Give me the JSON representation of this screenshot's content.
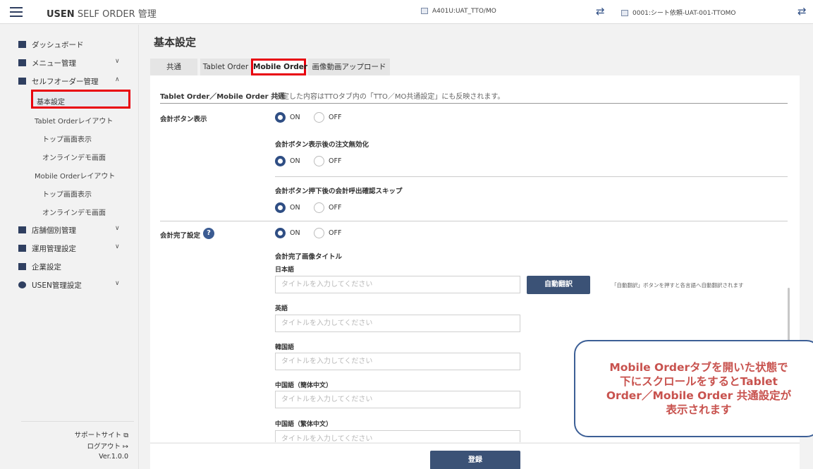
{
  "header": {
    "brand_bold": "USEN",
    "brand_rest": " SELF ORDER 管理",
    "store": "A401U:UAT_TTO/MO",
    "terminal": "0001:シート依頼-UAT-001-TTOMO",
    "swap_glyph": "⇄"
  },
  "sidebar": {
    "items": [
      {
        "label": "ダッシュボード",
        "icon": "dashboard-icon"
      },
      {
        "label": "メニュー管理",
        "icon": "book-icon",
        "chevron": "∨"
      },
      {
        "label": "セルフオーダー管理",
        "icon": "tablet-icon",
        "chevron": "∧"
      },
      {
        "label": "店舗個別管理",
        "icon": "store-icon",
        "chevron": "∨"
      },
      {
        "label": "運用管理設定",
        "icon": "monitor-icon",
        "chevron": "∨"
      },
      {
        "label": "企業設定",
        "icon": "building-icon"
      },
      {
        "label": "USEN管理設定",
        "icon": "admin-gear-icon",
        "chevron": "∨"
      }
    ],
    "sub": {
      "basic": "基本設定",
      "tablet_layout": "Tablet Orderレイアウト",
      "top_display_1": "トップ画面表示",
      "online_demo_1": "オンラインデモ画面",
      "mobile_layout": "Mobile Orderレイアウト",
      "top_display_2": "トップ画面表示",
      "online_demo_2": "オンラインデモ画面"
    },
    "footer": {
      "support": "サポートサイト",
      "support_icon": "⧉",
      "logout": "ログアウト",
      "logout_icon": "↦",
      "version": "Ver.1.0.0"
    }
  },
  "main": {
    "title": "基本設定",
    "tabs": [
      "共通",
      "Tablet Order",
      "Mobile Order",
      "画像動画アップロード"
    ],
    "section_heading": "Tablet Order／Mobile Order 共通",
    "section_note": "設定した内容はTTOタブ内の「TTO／MO共通設定」にも反映されます。",
    "checkout_button_display": "会計ボタン表示",
    "disable_after_display": "会計ボタン表示後の注文無効化",
    "skip_confirm": "会計ボタン押下後の会計呼出確認スキップ",
    "completion_setting": "会計完了設定",
    "help_glyph": "?",
    "completion_title": "会計完了画像タイトル",
    "on": "ON",
    "off": "OFF",
    "lang_ja": "日本語",
    "lang_en": "英語",
    "lang_ko": "韓国語",
    "lang_zh_hans": "中国語（簡体中文）",
    "lang_zh_hant": "中国語（繁体中文）",
    "placeholder": "タイトルを入力してください",
    "auto_translate": "自動翻訳",
    "auto_translate_note": "「自動翻訳」ボタンを押すと各言語へ自動翻訳されます",
    "register": "登録"
  },
  "callout": {
    "line1": "Mobile Orderタブを開いた状態で",
    "line2": "下にスクロールをするとTablet",
    "line3": "Order／Mobile Order 共通設定が",
    "line4": "表示されます"
  },
  "colors": {
    "accent": "#2f4e84",
    "highlight": "#e8000d",
    "callout_text": "#c8524e"
  }
}
